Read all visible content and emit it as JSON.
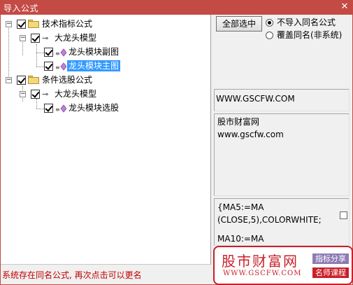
{
  "window": {
    "title": "导入公式",
    "close_glyph": "✕"
  },
  "tree": {
    "nodes": [
      {
        "label": "技术指标公式"
      },
      {
        "label": "大龙头模型"
      },
      {
        "label": "龙头模块副图"
      },
      {
        "label": "龙头模块主图"
      },
      {
        "label": "条件选股公式"
      },
      {
        "label": "大龙头模型"
      },
      {
        "label": "龙头模块选股"
      }
    ]
  },
  "controls": {
    "select_all_label": "全部选中",
    "radio_no_import_label": "不导入同名公式",
    "radio_overwrite_label": "覆盖同名(非系统)"
  },
  "info": {
    "url_line": "WWW.GSCFW.COM",
    "desc_line1": "股市财富网",
    "desc_line2": "www.gscfw.com",
    "code_line1": "{MA5:=MA",
    "code_line2": "(CLOSE,5),COLORWHITE;",
    "code_line3": "MA10:=MA"
  },
  "watermark": {
    "name_cn": "股市财富网",
    "url": "WWW.GSCFW.COM",
    "tag1": "指标分享",
    "tag2": "名师课程"
  },
  "status": {
    "message": "系统存在同名公式, 再次点击可以更名"
  },
  "colors": {
    "accent": "#c44a44",
    "selection": "#3399ff",
    "warning": "#c00000",
    "brand": "#c8202a"
  }
}
